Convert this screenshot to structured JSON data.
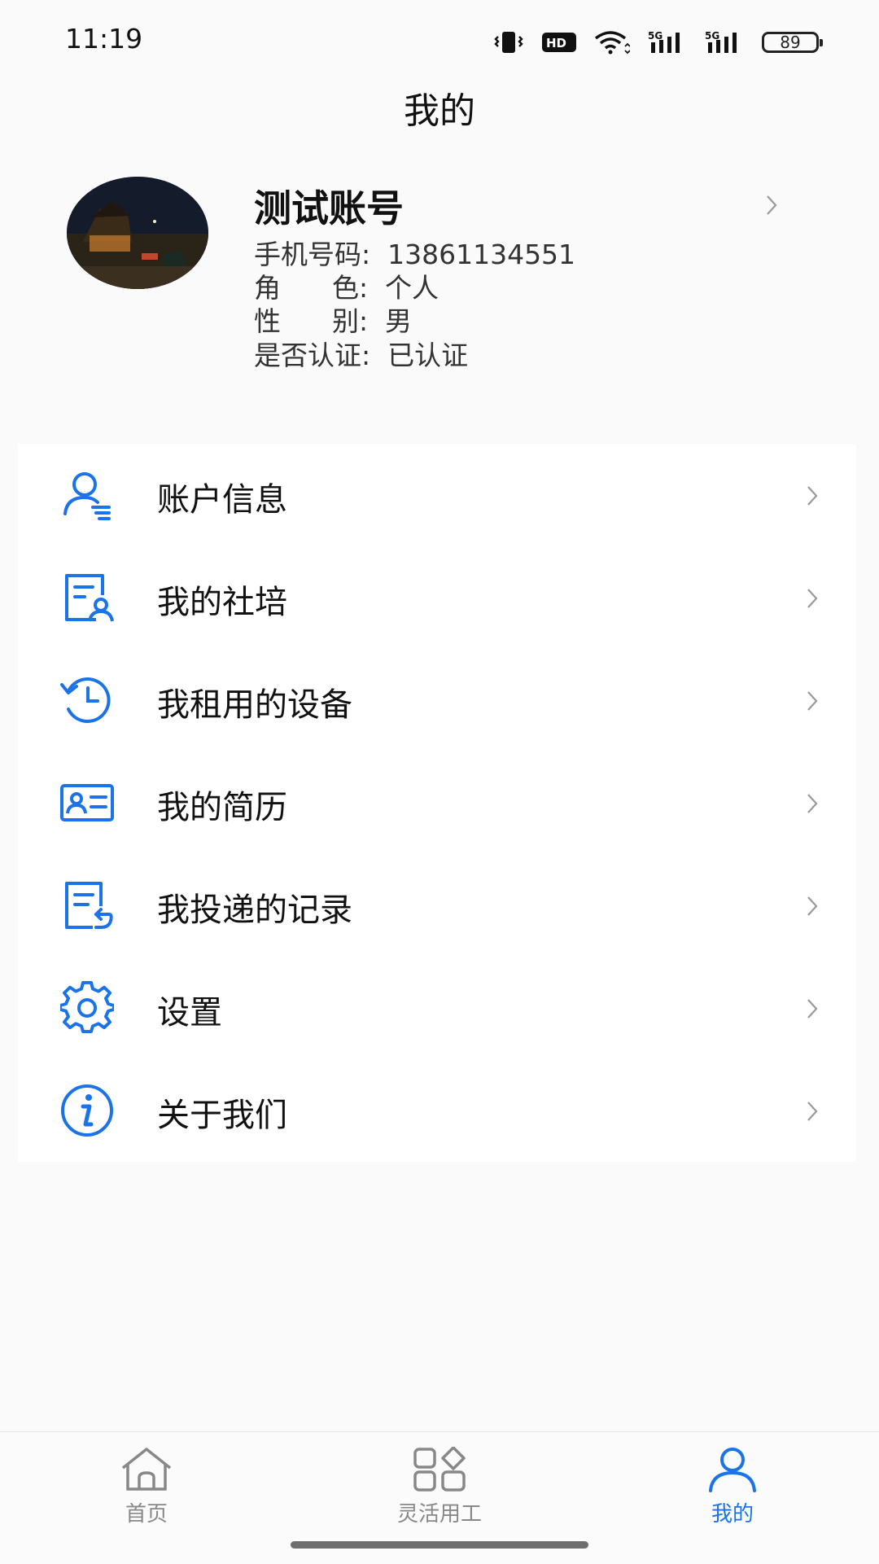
{
  "status_bar": {
    "time": "11:19",
    "battery_level": "89",
    "icons": [
      "vibrate-icon",
      "hd-icon",
      "wifi-icon",
      "signal-5g-icon",
      "signal-5g-icon",
      "battery-icon"
    ]
  },
  "header": {
    "title": "我的"
  },
  "profile": {
    "name": "测试账号",
    "phone_line": "手机号码:  13861134551",
    "role_line": "角      色:  个人",
    "gender_line": "性      别:  男",
    "verified_line": "是否认证:  已认证"
  },
  "menu": {
    "items": [
      {
        "label": "账户信息",
        "icon": "account-info-icon"
      },
      {
        "label": "我的社培",
        "icon": "training-icon"
      },
      {
        "label": "我租用的设备",
        "icon": "rented-equipment-icon"
      },
      {
        "label": "我的简历",
        "icon": "resume-icon"
      },
      {
        "label": "我投递的记录",
        "icon": "delivery-record-icon"
      },
      {
        "label": "设置",
        "icon": "gear-icon"
      },
      {
        "label": "关于我们",
        "icon": "info-icon"
      }
    ]
  },
  "tabbar": {
    "tabs": [
      {
        "label": "首页",
        "icon": "home-icon"
      },
      {
        "label": "灵活用工",
        "icon": "apps-icon"
      },
      {
        "label": "我的",
        "icon": "user-icon"
      }
    ],
    "active": "我的"
  },
  "colors": {
    "accent": "#1a73e8",
    "text": "#111111",
    "muted": "#888888",
    "background": "#fafafa"
  }
}
